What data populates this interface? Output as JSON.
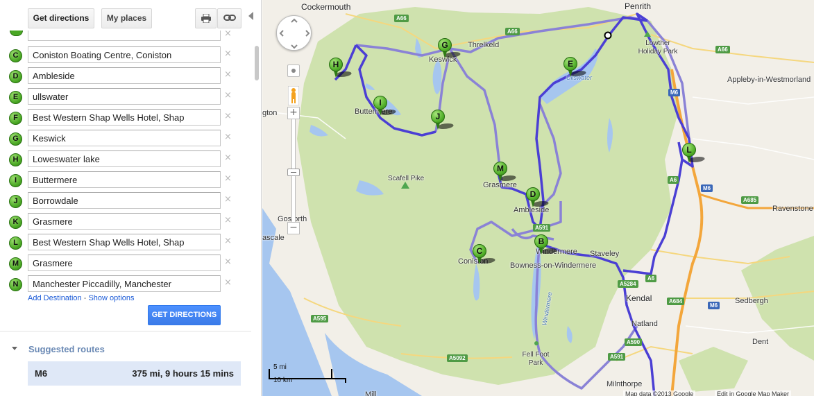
{
  "toolbar": {
    "get_directions_label": "Get directions",
    "my_places_label": "My places",
    "print_icon": "printer-icon",
    "link_icon": "link-icon"
  },
  "stops": [
    {
      "letter": "C",
      "value": "Coniston Boating Centre, Coniston"
    },
    {
      "letter": "D",
      "value": "Ambleside"
    },
    {
      "letter": "E",
      "value": "ullswater"
    },
    {
      "letter": "F",
      "value": "Best Western Shap Wells Hotel, Shap"
    },
    {
      "letter": "G",
      "value": "Keswick"
    },
    {
      "letter": "H",
      "value": "Loweswater lake"
    },
    {
      "letter": "I",
      "value": "Buttermere"
    },
    {
      "letter": "J",
      "value": "Borrowdale"
    },
    {
      "letter": "K",
      "value": "Grasmere"
    },
    {
      "letter": "L",
      "value": "Best Western Shap Wells Hotel, Shap"
    },
    {
      "letter": "M",
      "value": "Grasmere"
    },
    {
      "letter": "N",
      "value": "Manchester Piccadilly, Manchester"
    }
  ],
  "remove_glyph": "×",
  "links": {
    "add_destination": "Add Destination",
    "separator": " - ",
    "show_options": "Show options"
  },
  "go_button": "GET DIRECTIONS",
  "routes": {
    "title": "Suggested routes",
    "items": [
      {
        "name": "M6",
        "info": "375 mi, 9 hours 15 mins"
      }
    ]
  },
  "map": {
    "labels": {
      "cockermouth": "Cockermouth",
      "penrith": "Penrith",
      "lowther_park": "Lowther Holiday Park",
      "appleby": "Appleby-in-Westmorland",
      "threlkeld": "Threlkeld",
      "keswick": "Keswick",
      "ullswater": "Ullswater",
      "gton": "gton",
      "buttermere": "Buttermere",
      "scafell": "Scafell Pike",
      "grasmere": "Grasmere",
      "ambleside": "Ambleside",
      "ravenstone": "Ravenstone",
      "gosforth": "Gosforth",
      "ascale": "ascale",
      "windermere": "Windermere",
      "staveley": "Staveley",
      "coniston": "Coniston",
      "bowness": "Bowness-on-Windermere",
      "kendal": "Kendal",
      "sedbergh": "Sedbergh",
      "natland": "Natland",
      "dent": "Dent",
      "fell_foot": "Fell Foot Park",
      "windermere_lake": "Windermere",
      "milnthorpe": "Milnthorpe",
      "mill": "Mill"
    },
    "shields": {
      "a66_w": "A66",
      "a66_n": "A66",
      "a66_e": "A66",
      "m6_n": "M6",
      "a6_n": "A6",
      "m6_mid": "M6",
      "a685": "A685",
      "a591": "A591",
      "a6": "A6",
      "a5284": "A5284",
      "a684": "A684",
      "m6_s": "M6",
      "a595": "A595",
      "a5092": "A5092",
      "a590": "A590",
      "a591_s": "A591"
    },
    "markers": [
      "G",
      "H",
      "E",
      "I",
      "J",
      "L",
      "M",
      "D",
      "C",
      "B"
    ],
    "scale": {
      "mi": "5 mi",
      "km": "10 km"
    },
    "copyright": "Map data ©2013 Google",
    "edit_link": "Edit in Google Map Maker",
    "colors": {
      "land": "#f2efe8",
      "park": "#cfe2ae",
      "water": "#a6c6ef",
      "route": "#4b3fd4",
      "route_alt": "#8a82d6",
      "motorway": "#f3a63b",
      "marker": "#55b22c"
    }
  }
}
